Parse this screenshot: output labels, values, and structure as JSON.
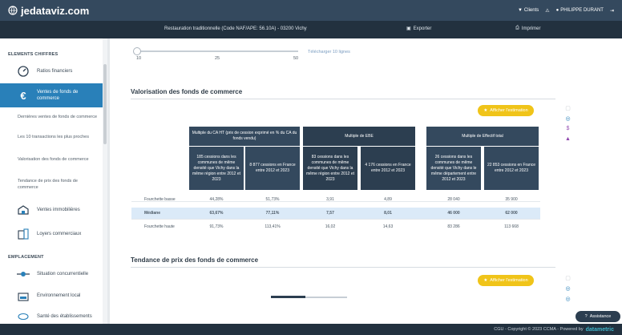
{
  "app": {
    "logo_text": "jedataviz.com"
  },
  "topbar": {
    "clients": "Clients",
    "user": "PHILIPPE DURANT"
  },
  "subbar": {
    "title": "Restauration traditionnelle (Code NAF/APE: 56.10A) - 03200 Vichy",
    "export": "Exporter",
    "print": "Imprimer"
  },
  "sidebar": {
    "section1": "ELEMENTS CHIFFRES",
    "ratios": "Ratios financiers",
    "ventes_fonds": "Ventes de fonds de commerce",
    "sub_items": [
      "Dernières ventes de fonds de commerce",
      "Les 10 transactions les plus proches",
      "Valorisation des fonds de commerce",
      "Tendance de prix des fonds de commerce"
    ],
    "ventes_immo": "Ventes immobilières",
    "loyers": "Loyers commerciaux",
    "section2": "EMPLACEMENT",
    "concurrence": "Situation concurrentielle",
    "environnement": "Environnement local",
    "sante": "Santé des établissements"
  },
  "slider": {
    "ticks": [
      "10",
      "25",
      "50"
    ],
    "download": "Télécharger 10 lignes",
    "value": 0
  },
  "valorisation": {
    "title": "Valorisation des fonds de commerce",
    "button": "Afficher l'estimation",
    "groups": [
      "Multiple du CA HT (prix de cession exprimé en % du CA du fonds vendu)",
      "Multiple de EBE",
      "Multiple de Effectif total"
    ],
    "subheaders": [
      "185 cessions dans les communes de même densité que Vichy dans la même région entre 2012 et 2023",
      "8 877 cessions en France entre 2012 et 2023",
      "83 cessions dans les communes de même densité que Vichy dans la même région entre 2012 et 2023",
      "4 176 cessions en France entre 2012 et 2023",
      "26 cessions dans les communes de même densité que Vichy dans le même département entre 2012 et 2023",
      "22 853 cessions en France entre 2012 et 2023"
    ],
    "rows": [
      {
        "label": "Fourchette basse",
        "values": [
          "44,28%",
          "51,73%",
          "3,91",
          "4,89",
          "28 040",
          "35 900"
        ]
      },
      {
        "label": "Médiane",
        "values": [
          "63,67%",
          "77,11%",
          "7,57",
          "8,01",
          "46 000",
          "62 000"
        ]
      },
      {
        "label": "Fourchette haute",
        "values": [
          "91,73%",
          "113,41%",
          "16,02",
          "14,63",
          "83 286",
          "113 668"
        ]
      }
    ]
  },
  "tendance": {
    "title": "Tendance de prix des fonds de commerce",
    "button": "Afficher l'estimation",
    "progress": 0.45
  },
  "assist": {
    "label": "Assistance"
  },
  "footer": {
    "text": "CGU - Copyright © 2023 CCMA - Powered by",
    "brand": "datametric"
  },
  "colors": {
    "accent": "#2980b9",
    "header": "#34495e",
    "button": "#f0c419",
    "highlight": "#dbeaf8"
  }
}
